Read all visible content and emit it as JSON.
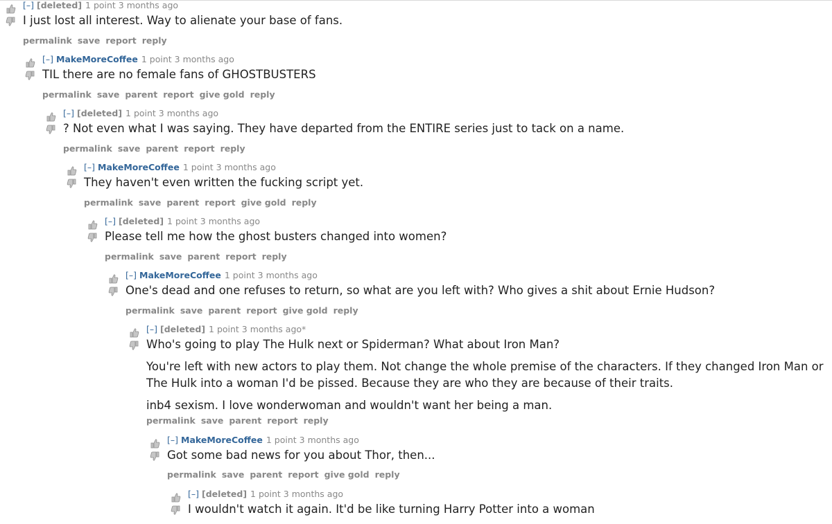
{
  "comments": [
    {
      "expand": "[–]",
      "author": "[deleted]",
      "meta": "1 point 3 months ago",
      "paragraphs": [
        "I just lost all interest. Way to alienate your base of fans."
      ],
      "buttons": [
        "permalink",
        "save",
        "report",
        "reply"
      ]
    },
    {
      "expand": "[–]",
      "author": "MakeMoreCoffee",
      "meta": "1 point 3 months ago",
      "paragraphs": [
        "TIL there are no female fans of GHOSTBUSTERS"
      ],
      "buttons": [
        "permalink",
        "save",
        "parent",
        "report",
        "give gold",
        "reply"
      ]
    },
    {
      "expand": "[–]",
      "author": "[deleted]",
      "meta": "1 point 3 months ago",
      "paragraphs": [
        "? Not even what I was saying. They have departed from the ENTIRE series just to tack on a name."
      ],
      "buttons": [
        "permalink",
        "save",
        "parent",
        "report",
        "reply"
      ]
    },
    {
      "expand": "[–]",
      "author": "MakeMoreCoffee",
      "meta": "1 point 3 months ago",
      "paragraphs": [
        "They haven't even written the fucking script yet."
      ],
      "buttons": [
        "permalink",
        "save",
        "parent",
        "report",
        "give gold",
        "reply"
      ]
    },
    {
      "expand": "[–]",
      "author": "[deleted]",
      "meta": "1 point 3 months ago",
      "paragraphs": [
        "Please tell me how the ghost busters changed into women?"
      ],
      "buttons": [
        "permalink",
        "save",
        "parent",
        "report",
        "reply"
      ]
    },
    {
      "expand": "[–]",
      "author": "MakeMoreCoffee",
      "meta": "1 point 3 months ago",
      "paragraphs": [
        "One's dead and one refuses to return, so what are you left with? Who gives a shit about Ernie Hudson?"
      ],
      "buttons": [
        "permalink",
        "save",
        "parent",
        "report",
        "give gold",
        "reply"
      ]
    },
    {
      "expand": "[–]",
      "author": "[deleted]",
      "meta": "1 point 3 months ago*",
      "paragraphs": [
        "Who's going to play The Hulk next or Spiderman? What about Iron Man?",
        "You're left with new actors to play them. Not change the whole premise of the characters. If they changed Iron Man or",
        "The Hulk into a woman I'd be pissed. Because they are who they are because of their traits.",
        "inb4 sexism. I love wonderwoman and wouldn't want her being a man."
      ],
      "buttons": [
        "permalink",
        "save",
        "parent",
        "report",
        "reply"
      ]
    },
    {
      "expand": "[–]",
      "author": "MakeMoreCoffee",
      "meta": "1 point 3 months ago",
      "paragraphs": [
        "Got some bad news for you about Thor, then..."
      ],
      "buttons": [
        "permalink",
        "save",
        "parent",
        "report",
        "give gold",
        "reply"
      ]
    },
    {
      "expand": "[–]",
      "author": "[deleted]",
      "meta": "1 point 3 months ago",
      "paragraphs": [
        "I wouldn't watch it again. It'd be like turning Harry Potter into a woman"
      ],
      "buttons": []
    }
  ],
  "colors": {
    "author_link": "#336699",
    "meta_gray": "#888888",
    "body_text": "#222222",
    "vote_arrow": "#c6c6c6"
  },
  "icons": {
    "upvote": "thumbs-up-icon",
    "downvote": "thumbs-down-icon"
  }
}
